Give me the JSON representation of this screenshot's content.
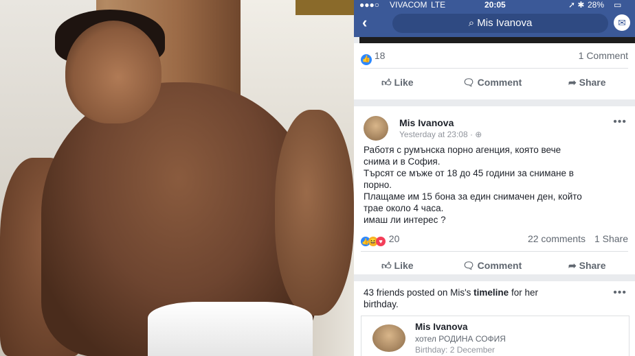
{
  "status": {
    "carrier": "VIVACOM",
    "network": "LTE",
    "time": "20:05",
    "battery": "28%"
  },
  "nav": {
    "search_text": "Mis Ivanova"
  },
  "prev_post": {
    "likes": "18",
    "comments": "1 Comment",
    "like_label": "Like",
    "comment_label": "Comment",
    "share_label": "Share"
  },
  "post": {
    "author": "Mis Ivanova",
    "timestamp": "Yesterday at 23:08 · ",
    "lines": [
      "Работя с румънска порно агенция, която вече",
      "снима и в София.",
      "Търсят се мъже от 18 до 45 години за снимане в",
      "порно.",
      "Плащаме им 15 бона за един снимачен ден, който",
      "трае около 4 часа.",
      "имаш ли интерес ?"
    ],
    "reactions": "20",
    "comments": "22 comments",
    "shares": "1 Share",
    "like_label": "Like",
    "comment_label": "Comment",
    "share_label": "Share"
  },
  "birthday": {
    "text_prefix": "43 friends posted on Mis's ",
    "text_bold": "timeline",
    "text_suffix": " for her birthday.",
    "name": "Mis Ivanova",
    "place": "хотел РОДИНА СОФИЯ",
    "bday": "Birthday: 2 December"
  },
  "colors": {
    "fb_blue": "#3b5998",
    "like_blue": "#2d88ff",
    "text": "#1d2129",
    "muted": "#606770"
  }
}
